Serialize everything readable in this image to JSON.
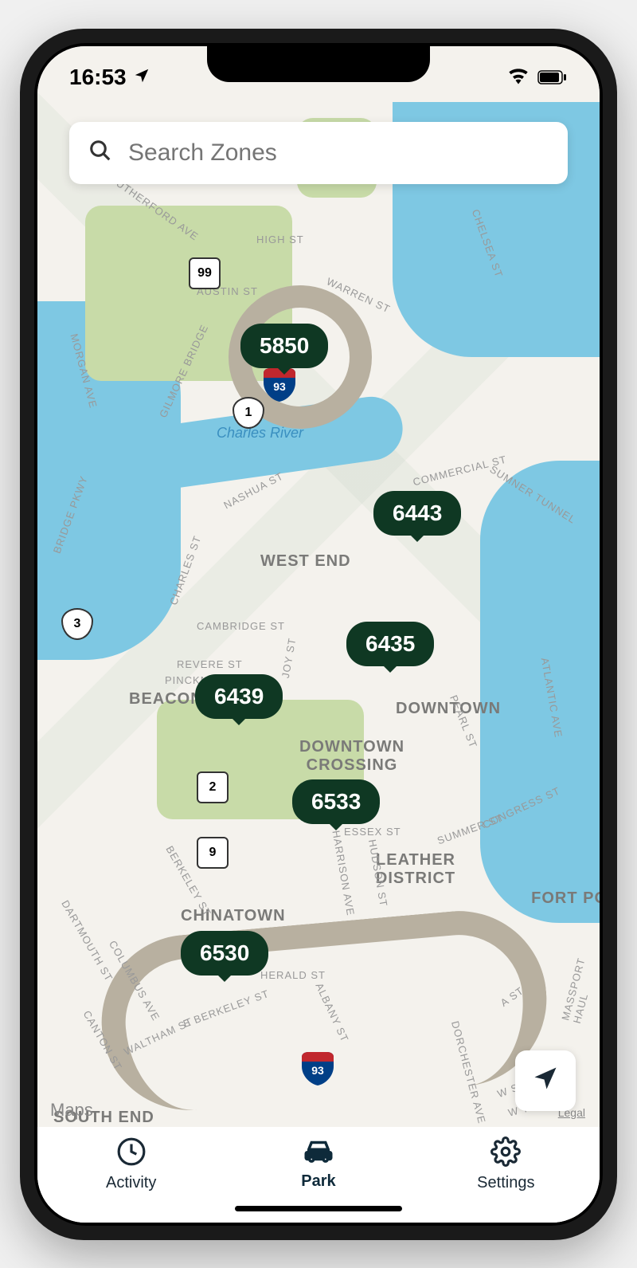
{
  "status": {
    "time": "16:53"
  },
  "search": {
    "placeholder": "Search Zones"
  },
  "map": {
    "attribution": "Maps",
    "legal": "Legal",
    "river": "Charles River",
    "areas": {
      "westend": "WEST END",
      "beaconhill": "BEACON HILL",
      "downtown": "DOWNTOWN",
      "dtx": "DOWNTOWN CROSSING",
      "leather": "LEATHER DISTRICT",
      "chinatown": "CHINATOWN",
      "fortpoint": "FORT PO",
      "southend": "SOUTH END"
    },
    "streets": {
      "highst": "HIGH ST",
      "austin": "AUSTIN ST",
      "warren": "WARREN ST",
      "chelsea": "CHELSEA ST",
      "gilmore": "GILMORE BRIDGE",
      "morgan": "MORGAN AVE",
      "rutherford": "RUTHERFORD AVE",
      "commercial": "COMMERCIAL ST",
      "sumner": "SUMNER TUNNEL",
      "nashua": "NASHUA ST",
      "charles": "CHARLES ST",
      "cambridge": "CAMBRIDGE ST",
      "revere": "REVERE ST",
      "pinckney": "PINCKNEY ST",
      "joy": "JOY ST",
      "pearl": "PEARL ST",
      "atlantic": "ATLANTIC AVE",
      "essex": "ESSEX ST",
      "summer": "SUMMER ST",
      "congress": "CONGRESS ST",
      "harrison": "HARRISON AVE",
      "hudson": "HUDSON ST",
      "albany": "ALBANY ST",
      "berkeley": "BERKELEY ST",
      "columbus": "COLUMBUS AVE",
      "dartmouth": "DARTMOUTH ST",
      "canton": "CANTON ST",
      "waltham": "WALTHAM ST",
      "eberkeley": "E BERKELEY ST",
      "herald": "HERALD ST",
      "dorchester": "DORCHESTER AVE",
      "wsecond": "W SECOND ST",
      "wthird": "W THIRD ST",
      "ast": "A ST",
      "massport": "MASSPORT HAUL",
      "bridgepkwy": "BRIDGE PKWY"
    },
    "shields": {
      "r99": "99",
      "r1": "1",
      "r3": "3",
      "r2": "2",
      "r9": "9",
      "i93": "93"
    }
  },
  "zones": [
    {
      "id": "5850"
    },
    {
      "id": "6443"
    },
    {
      "id": "6435"
    },
    {
      "id": "6439"
    },
    {
      "id": "6533"
    },
    {
      "id": "6530"
    }
  ],
  "tabs": {
    "activity": "Activity",
    "park": "Park",
    "settings": "Settings"
  }
}
